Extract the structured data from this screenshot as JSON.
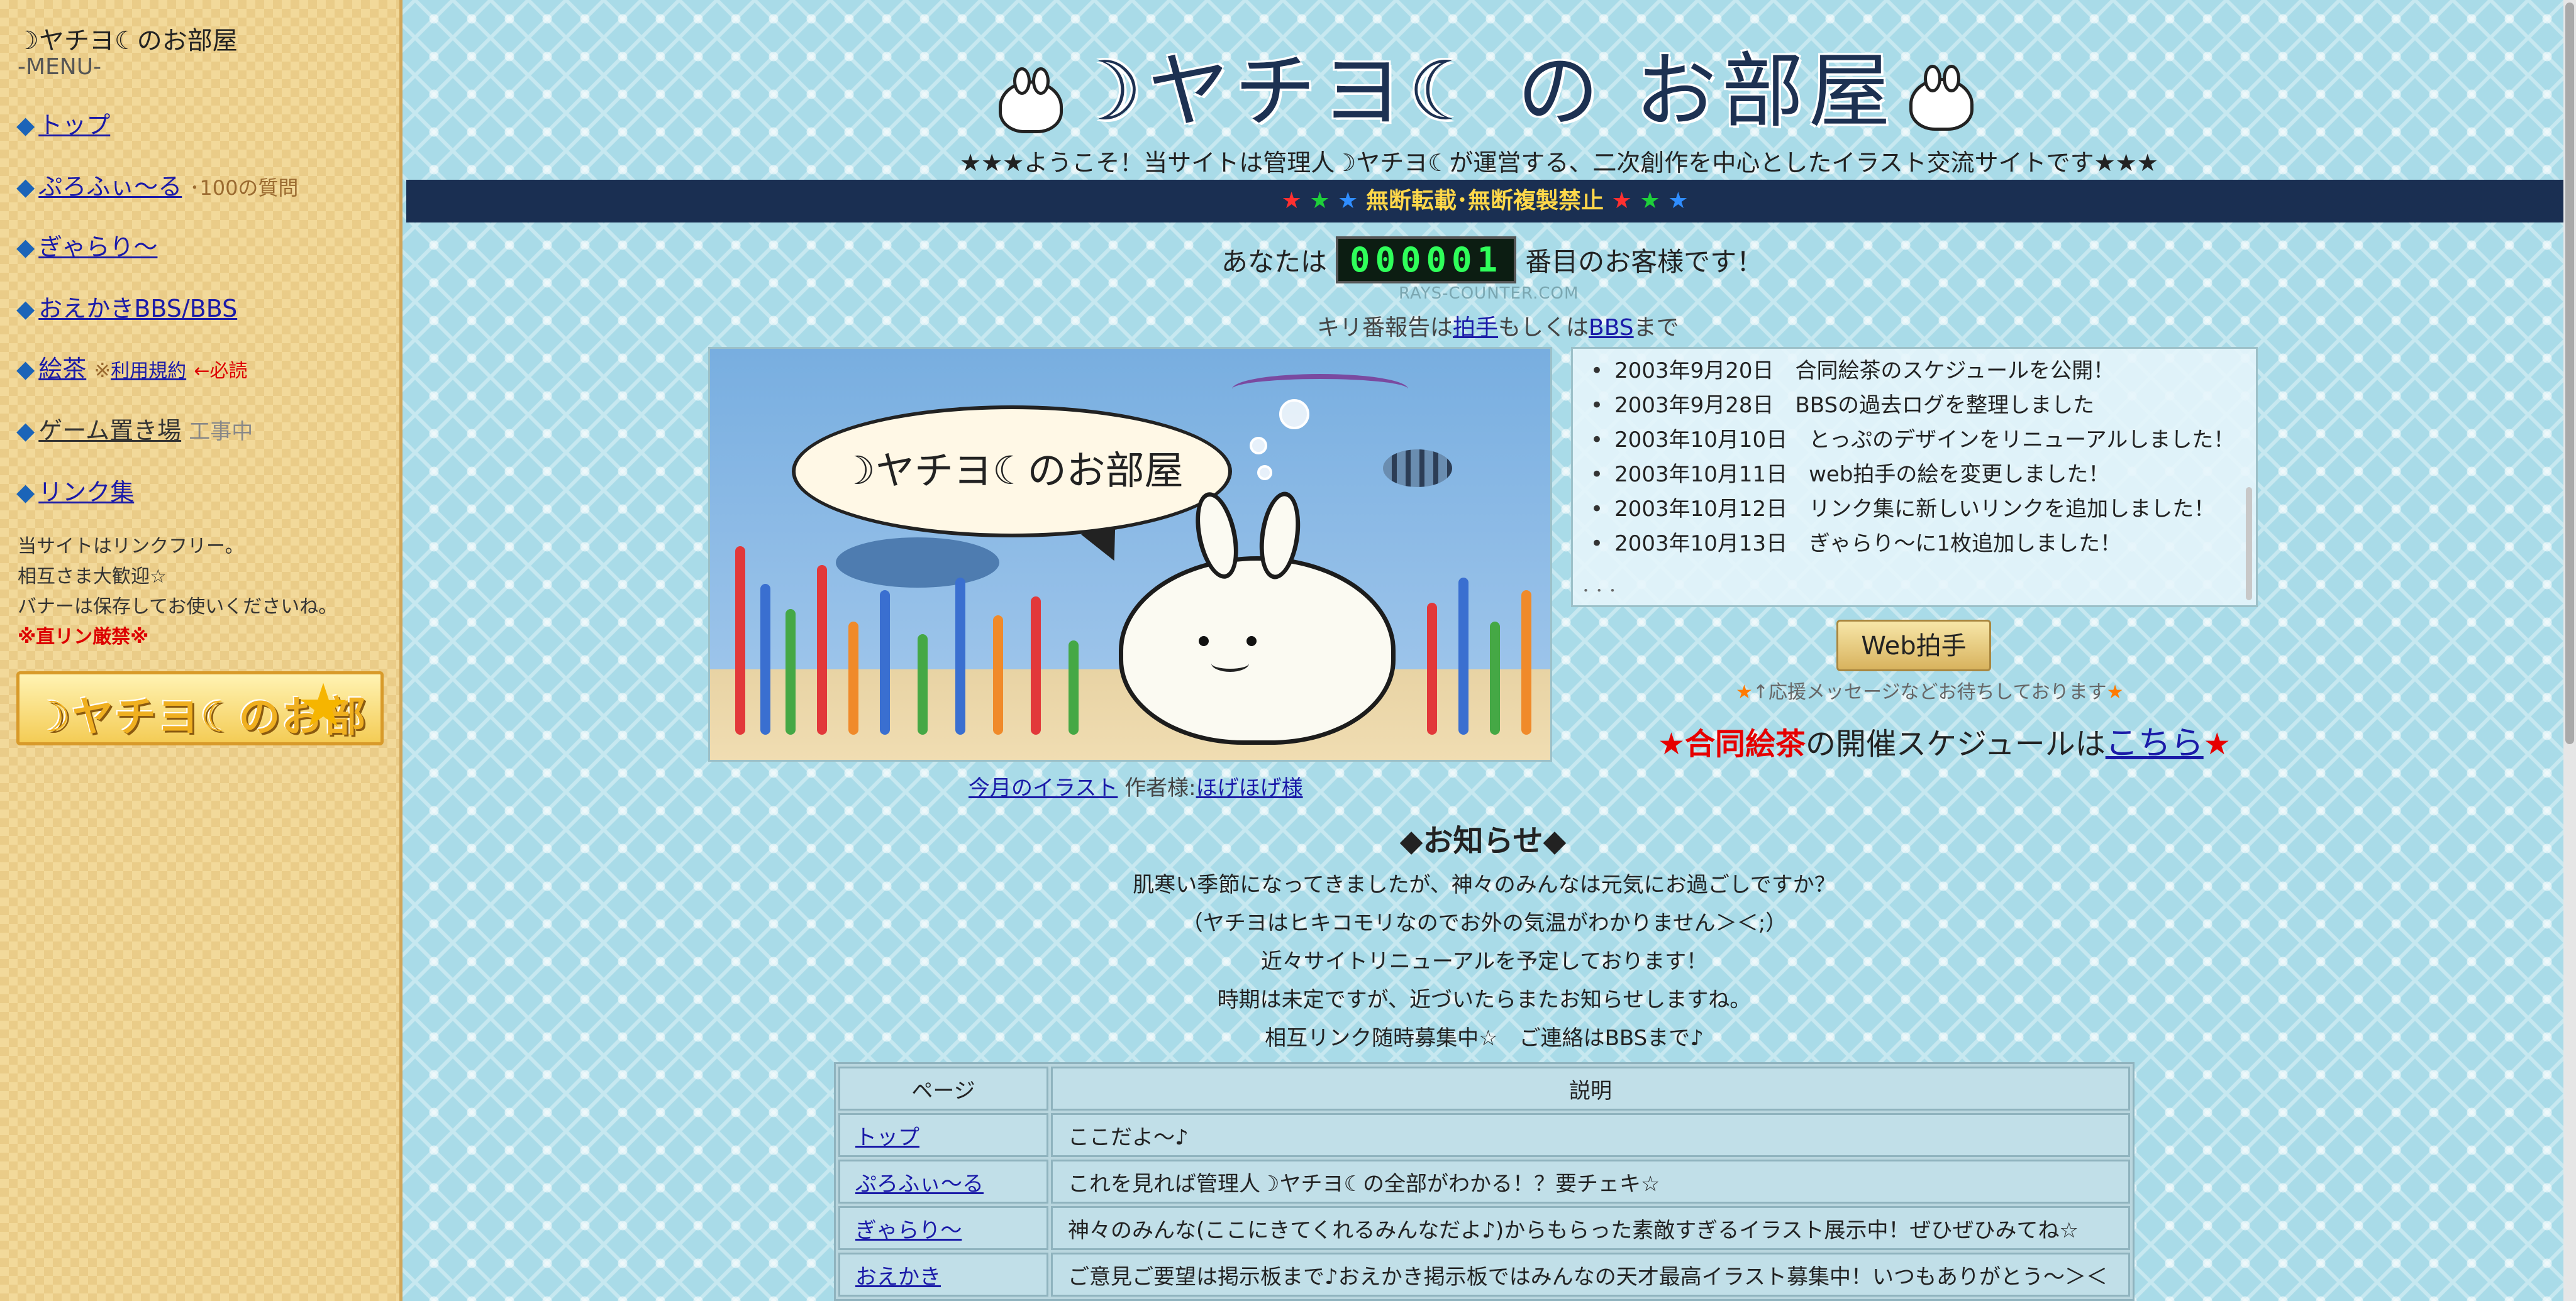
{
  "sidebar": {
    "title": "☽ヤチヨ☾のお部屋",
    "menu_label": "-MENU-",
    "items": {
      "top": "トップ",
      "profile": "ぷろふぃ～る",
      "profile_sub": "･100の質問",
      "gallery": "ぎゃらり～",
      "oekaki": "おえかきBBS/BBS",
      "echa": "絵茶",
      "echa_note": "※",
      "echa_rules": "利用規約",
      "echa_required": "←必読",
      "game": "ゲーム置き場",
      "game_status": "工事中",
      "links": "リンク集"
    },
    "notes": [
      "当サイトはリンクフリー。",
      "相互さま大歓迎☆",
      "バナーは保存してお使いくださいね。"
    ],
    "warning": "※直リン厳禁※",
    "banner_text": "☽ヤチヨ☾のお部屋"
  },
  "header": {
    "title": "☽ヤチヨ☾ の お部屋",
    "welcome": "★★★ようこそ！当サイトは管理人☽ヤチヨ☾が運営する、二次創作を中心としたイラスト交流サイトです★★★",
    "notice": "無断転載･無断複製禁止",
    "notice_stars": "★ ★ ★"
  },
  "counter": {
    "prefix": "あなたは",
    "value": "000001",
    "suffix": "番目のお客様です！",
    "credit": "RAYS-COUNTER.COM",
    "kiri_prefix": "キリ番報告は",
    "kiri_link1": "拍手",
    "kiri_mid": "もしくは",
    "kiri_link2": "BBS",
    "kiri_suffix": "まで"
  },
  "illustration": {
    "bubble_text": "☽ヤチヨ☾のお部屋",
    "caption_link": "今月のイラスト",
    "caption_author_label": "作者様:",
    "caption_author": "ほげほげ様"
  },
  "news": {
    "items": [
      "2003年9月20日　合同絵茶のスケジュールを公開！",
      "2003年9月28日　BBSの過去ログを整理しました",
      "2003年10月10日　とっぷのデザインをリニューアルしました！",
      "2003年10月11日　web拍手の絵を変更しました！",
      "2003年10月12日　リンク集に新しいリンクを追加しました！",
      "2003年10月13日　ぎゃらり～に1枚追加しました！"
    ],
    "more": "･ ･ ･"
  },
  "clap": {
    "button": "Web拍手",
    "note": "↑応援メッセージなどお待ちしております",
    "schedule_prefix": "合同絵茶",
    "schedule_mid": "の開催スケジュールは",
    "schedule_link": "こちら"
  },
  "oshirase": {
    "title": "◆お知らせ◆",
    "lines": [
      "肌寒い季節になってきましたが、神々のみんなは元気にお過ごしですか？",
      "（ヤチヨはヒキコモリなのでお外の気温がわかりません＞＜;）",
      "近々サイトリニューアルを予定しております！",
      "時期は未定ですが、近づいたらまたお知らせしますね。",
      "相互リンク随時募集中☆　ご連絡はBBSまで♪"
    ]
  },
  "table": {
    "headers": [
      "ページ",
      "説明"
    ],
    "rows": [
      {
        "page": "トップ",
        "desc": "ここだよ～♪"
      },
      {
        "page": "ぷろふぃ～る",
        "desc": "これを見れば管理人☽ヤチヨ☾の全部がわかる！？要チェキ☆"
      },
      {
        "page": "ぎゃらり～",
        "desc": "神々のみんな(ここにきてくれるみんなだよ♪)からもらった素敵すぎるイラスト展示中！ぜひぜひみてね☆"
      },
      {
        "page": "おえかき",
        "desc": "ご意見ご要望は掲示板まで♪おえかき掲示板ではみんなの天才最高イラスト募集中！いつもありがとう～＞＜"
      }
    ]
  },
  "colors": {
    "main_bg": "#a9dbe8",
    "sidebar_bg": "#f2d99a",
    "notice_bar": "#1a2f52",
    "link": "#1a1aa8",
    "warning": "#dd0000"
  }
}
